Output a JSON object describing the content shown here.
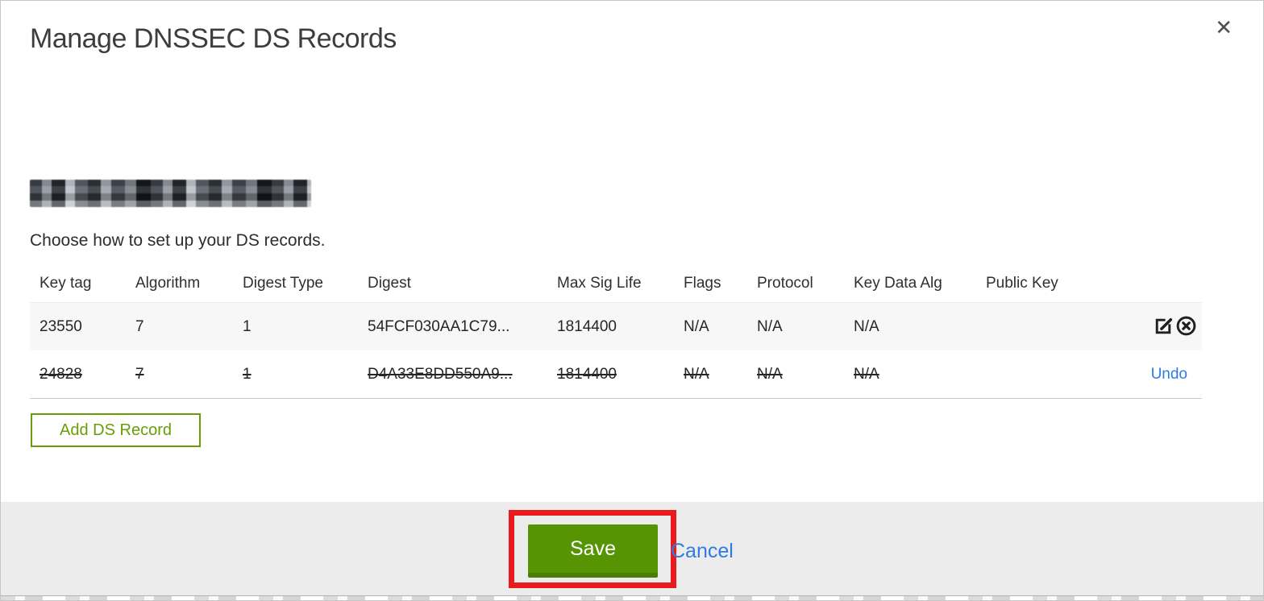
{
  "modal": {
    "title": "Manage DNSSEC DS Records",
    "close_label": "✕",
    "domain_redacted": true,
    "instruction": "Choose how to set up your DS records."
  },
  "table": {
    "columns": [
      "Key tag",
      "Algorithm",
      "Digest Type",
      "Digest",
      "Max Sig Life",
      "Flags",
      "Protocol",
      "Key Data Alg",
      "Public Key"
    ],
    "rows": [
      {
        "key_tag": "23550",
        "algorithm": "7",
        "digest_type": "1",
        "digest": "54FCF030AA1C79...",
        "max_sig_life": "1814400",
        "flags": "N/A",
        "protocol": "N/A",
        "key_data_alg": "N/A",
        "public_key": "",
        "state": "normal",
        "actions": [
          "edit-icon",
          "delete-icon"
        ]
      },
      {
        "key_tag": "24828",
        "algorithm": "7",
        "digest_type": "1",
        "digest": "D4A33E8DD550A9...",
        "max_sig_life": "1814400",
        "flags": "N/A",
        "protocol": "N/A",
        "key_data_alg": "N/A",
        "public_key": "",
        "state": "deleted",
        "undo_label": "Undo"
      }
    ]
  },
  "buttons": {
    "add_ds_record": "Add DS Record",
    "save": "Save",
    "cancel": "Cancel"
  },
  "colors": {
    "green_button": "#579404",
    "green_button_shadow": "#4a7d03",
    "green_outline": "#699d05",
    "link_blue": "#2f7ce0",
    "annotation_red": "#ea1b1e",
    "row_highlight_gray": "#f7f7f7",
    "footer_gray": "#ececec"
  }
}
